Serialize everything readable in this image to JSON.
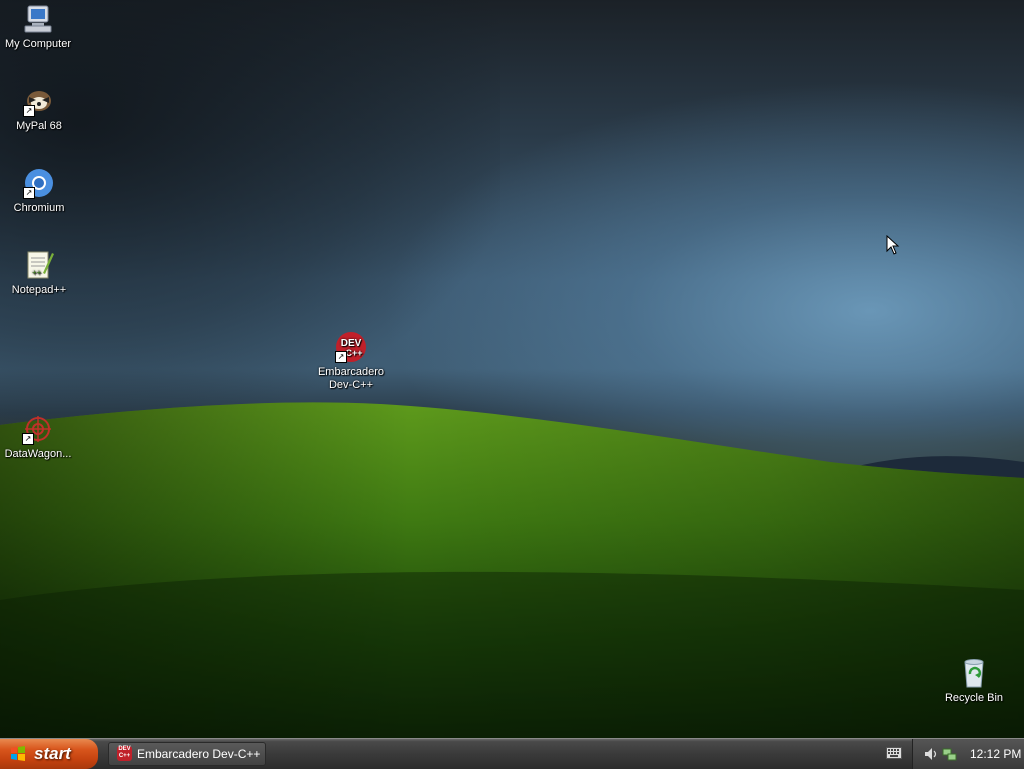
{
  "desktop": {
    "icons": [
      {
        "label": "My Computer",
        "icon": "my-computer-icon"
      },
      {
        "label": "MyPal 68",
        "icon": "mypal-icon"
      },
      {
        "label": "Chromium",
        "icon": "chromium-icon"
      },
      {
        "label": "Notepad++",
        "icon": "notepadpp-icon"
      },
      {
        "label": "Embarcadero Dev-C++",
        "icon": "devcpp-icon"
      },
      {
        "label": "DataWagon...",
        "icon": "datawagon-icon"
      },
      {
        "label": "Recycle Bin",
        "icon": "recycle-bin-icon"
      }
    ]
  },
  "devcpp_glyph_text": "DEV",
  "devcpp_glyph_sub": "C++",
  "taskbar": {
    "start_label": "start",
    "tasks": [
      {
        "label": "Embarcadero Dev-C++",
        "icon": "devcpp-icon"
      }
    ],
    "tray": {
      "clock": "12:12 PM"
    }
  },
  "colors": {
    "start_button": "#d8551c",
    "taskbar": "#3a3a3a",
    "devcpp_red": "#c0202a"
  }
}
